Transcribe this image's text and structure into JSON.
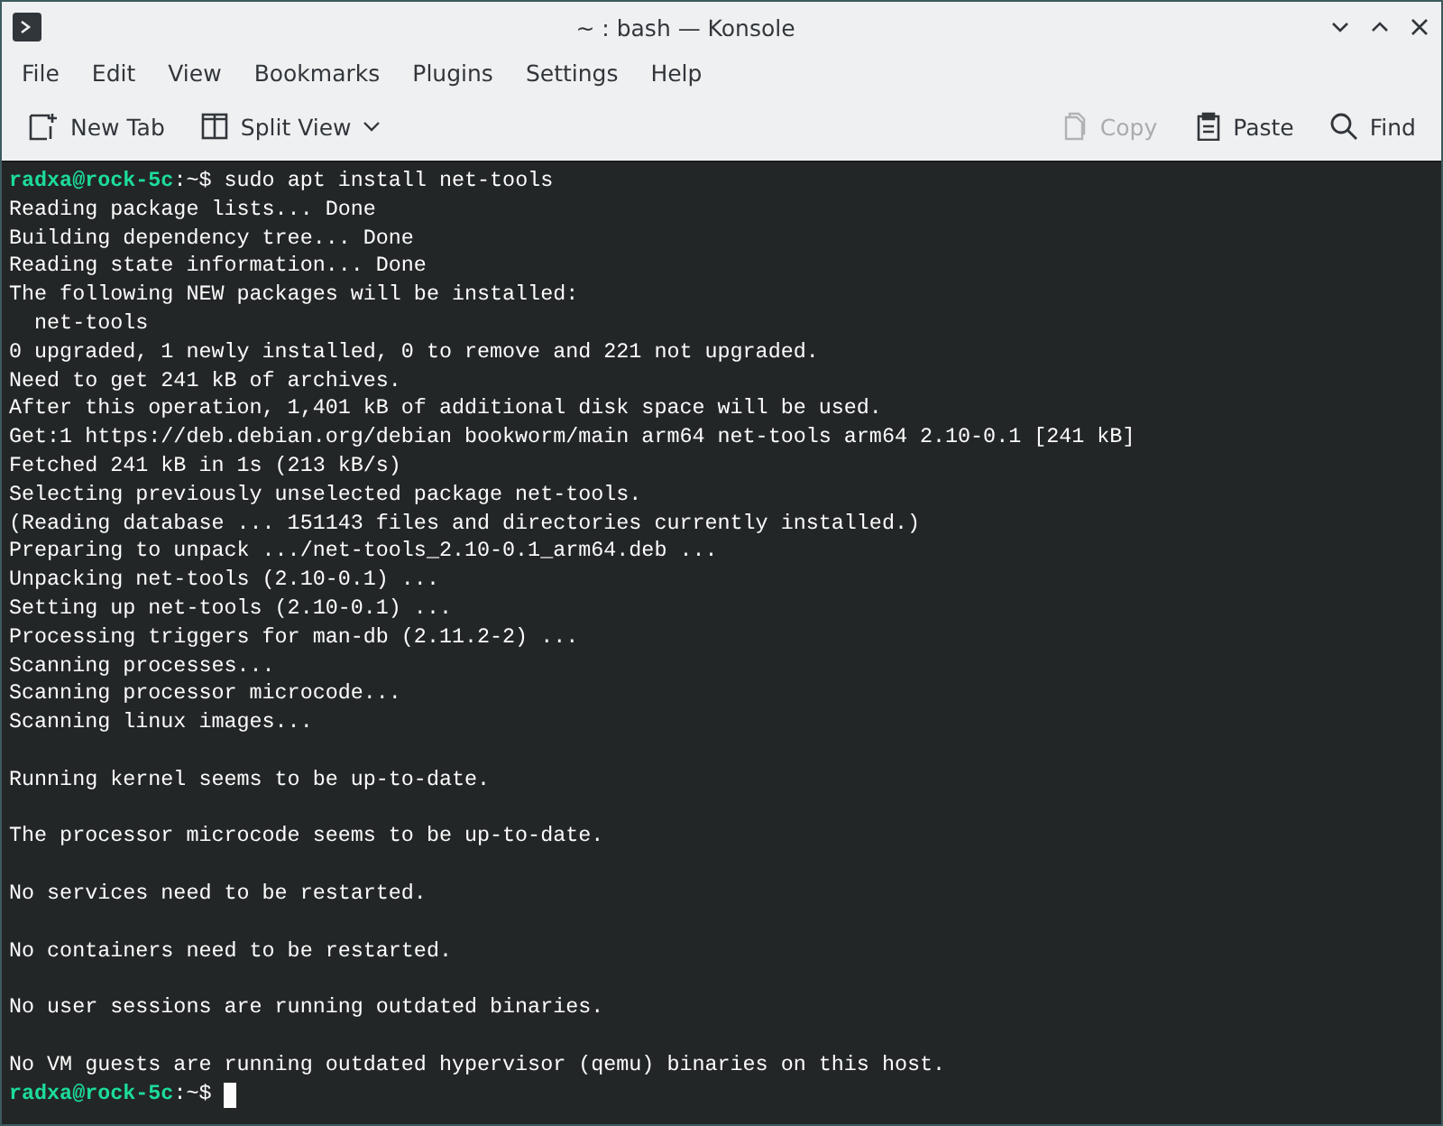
{
  "window": {
    "title": "~ : bash — Konsole"
  },
  "menu": [
    "File",
    "Edit",
    "View",
    "Bookmarks",
    "Plugins",
    "Settings",
    "Help"
  ],
  "toolbar": {
    "left": [
      {
        "kind": "new-tab",
        "label": "New Tab",
        "disabled": false
      },
      {
        "kind": "split-view",
        "label": "Split View",
        "disabled": false
      }
    ],
    "right": [
      {
        "kind": "copy",
        "label": "Copy",
        "disabled": true
      },
      {
        "kind": "paste",
        "label": "Paste",
        "disabled": false
      },
      {
        "kind": "find",
        "label": "Find",
        "disabled": false
      }
    ]
  },
  "terminal": {
    "lines": [
      {
        "kind": "prompt",
        "user": "radxa@rock-5c",
        "path": ":~$ ",
        "command": "sudo apt install net-tools"
      },
      {
        "kind": "output",
        "text": "Reading package lists... Done"
      },
      {
        "kind": "output",
        "text": "Building dependency tree... Done"
      },
      {
        "kind": "output",
        "text": "Reading state information... Done"
      },
      {
        "kind": "output",
        "text": "The following NEW packages will be installed:"
      },
      {
        "kind": "output",
        "text": "  net-tools"
      },
      {
        "kind": "output",
        "text": "0 upgraded, 1 newly installed, 0 to remove and 221 not upgraded."
      },
      {
        "kind": "output",
        "text": "Need to get 241 kB of archives."
      },
      {
        "kind": "output",
        "text": "After this operation, 1,401 kB of additional disk space will be used."
      },
      {
        "kind": "output",
        "text": "Get:1 https://deb.debian.org/debian bookworm/main arm64 net-tools arm64 2.10-0.1 [241 kB]"
      },
      {
        "kind": "output",
        "text": "Fetched 241 kB in 1s (213 kB/s)"
      },
      {
        "kind": "output",
        "text": "Selecting previously unselected package net-tools."
      },
      {
        "kind": "output",
        "text": "(Reading database ... 151143 files and directories currently installed.)"
      },
      {
        "kind": "output",
        "text": "Preparing to unpack .../net-tools_2.10-0.1_arm64.deb ..."
      },
      {
        "kind": "output",
        "text": "Unpacking net-tools (2.10-0.1) ..."
      },
      {
        "kind": "output",
        "text": "Setting up net-tools (2.10-0.1) ..."
      },
      {
        "kind": "output",
        "text": "Processing triggers for man-db (2.11.2-2) ..."
      },
      {
        "kind": "output",
        "text": "Scanning processes..."
      },
      {
        "kind": "output",
        "text": "Scanning processor microcode..."
      },
      {
        "kind": "output",
        "text": "Scanning linux images..."
      },
      {
        "kind": "blank"
      },
      {
        "kind": "output",
        "text": "Running kernel seems to be up-to-date."
      },
      {
        "kind": "blank"
      },
      {
        "kind": "output",
        "text": "The processor microcode seems to be up-to-date."
      },
      {
        "kind": "blank"
      },
      {
        "kind": "output",
        "text": "No services need to be restarted."
      },
      {
        "kind": "blank"
      },
      {
        "kind": "output",
        "text": "No containers need to be restarted."
      },
      {
        "kind": "blank"
      },
      {
        "kind": "output",
        "text": "No user sessions are running outdated binaries."
      },
      {
        "kind": "blank"
      },
      {
        "kind": "output",
        "text": "No VM guests are running outdated hypervisor (qemu) binaries on this host."
      },
      {
        "kind": "prompt",
        "user": "radxa@rock-5c",
        "path": ":~$ ",
        "cursor": true
      }
    ]
  }
}
